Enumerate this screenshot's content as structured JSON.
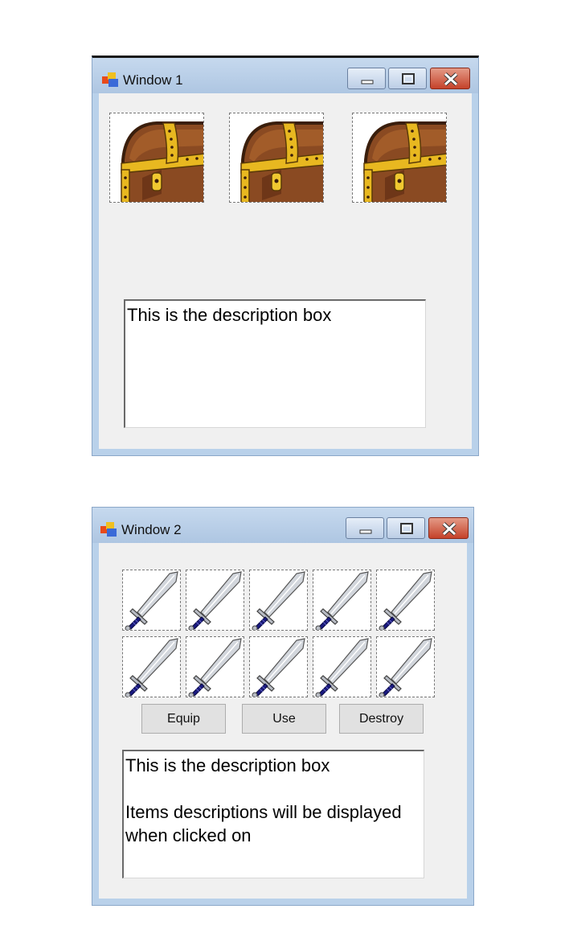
{
  "window1": {
    "title": "Window 1",
    "description": "This is the description box",
    "items": [
      {
        "icon": "treasure-chest-icon"
      },
      {
        "icon": "treasure-chest-icon"
      },
      {
        "icon": "treasure-chest-icon"
      }
    ]
  },
  "window2": {
    "title": "Window 2",
    "description_line1": "This is the description box",
    "description_line2": "Items descriptions will be displayed when clicked on",
    "items": [
      {
        "icon": "sword-icon"
      },
      {
        "icon": "sword-icon"
      },
      {
        "icon": "sword-icon"
      },
      {
        "icon": "sword-icon"
      },
      {
        "icon": "sword-icon"
      },
      {
        "icon": "sword-icon"
      },
      {
        "icon": "sword-icon"
      },
      {
        "icon": "sword-icon"
      },
      {
        "icon": "sword-icon"
      },
      {
        "icon": "sword-icon"
      }
    ],
    "buttons": {
      "equip": "Equip",
      "use": "Use",
      "destroy": "Destroy"
    }
  },
  "colors": {
    "titlebar": "#aec6e2",
    "client": "#f0f0f0",
    "close_button": "#c5422a",
    "chest_wood": "#8a4a22",
    "chest_gold": "#e8b820",
    "sword_hilt": "#1a1a80"
  }
}
